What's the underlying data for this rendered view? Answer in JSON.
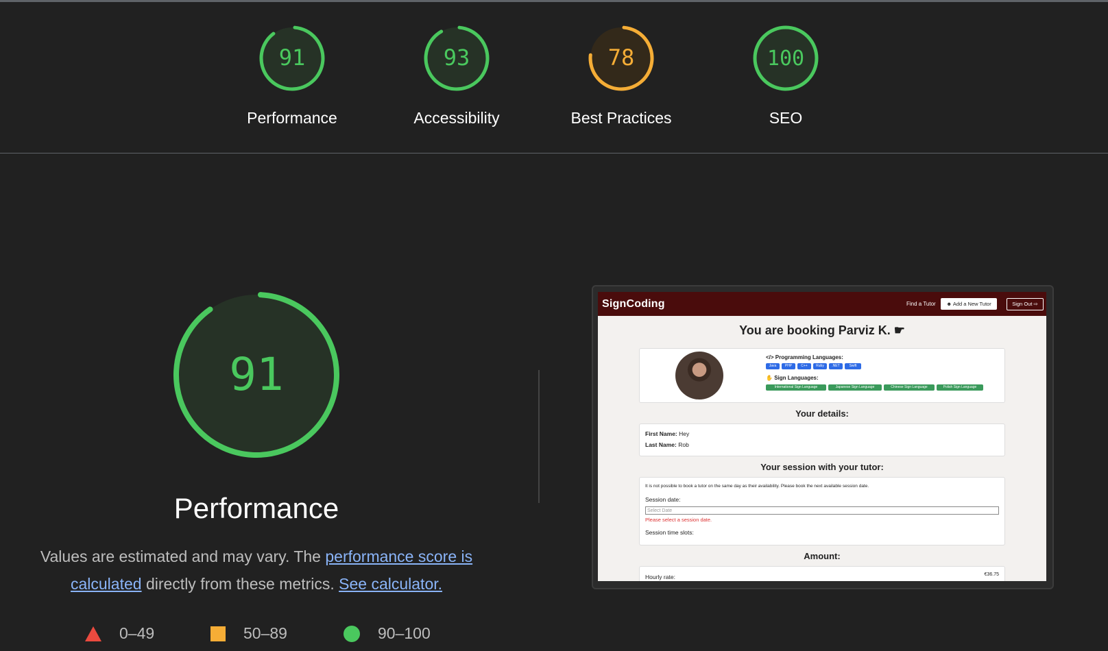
{
  "colors": {
    "good": "#0cce6b",
    "good_stroke": "#4ac85e",
    "average": "#ffa400",
    "poor": "#ff4e42",
    "background": "#212121",
    "link": "#8ab4f8"
  },
  "gauges": [
    {
      "score": "91",
      "label": "Performance",
      "level": "good"
    },
    {
      "score": "93",
      "label": "Accessibility",
      "level": "good"
    },
    {
      "score": "78",
      "label": "Best Practices",
      "level": "average"
    },
    {
      "score": "100",
      "label": "SEO",
      "level": "good"
    }
  ],
  "performance": {
    "score": "91",
    "title": "Performance",
    "desc_prefix": "Values are estimated and may vary. The ",
    "desc_link1": "performance score is calculated",
    "desc_middle": " directly from these metrics. ",
    "desc_link2": "See calculator."
  },
  "legend": [
    {
      "icon": "red-triangle-icon",
      "range": "0–49"
    },
    {
      "icon": "orange-square-icon",
      "range": "50–89"
    },
    {
      "icon": "green-circle-icon",
      "range": "90–100"
    }
  ],
  "screenshot": {
    "brand": "SignCoding",
    "nav_find": "Find a Tutor",
    "nav_add": "Add a New Tutor",
    "nav_signout": "Sign Out",
    "heading": "You are booking Parviz K.",
    "prog_lang_label": "</> Programming Languages:",
    "prog_langs": [
      "Java",
      "PHP",
      "C++",
      "Ruby",
      ".NET",
      "Swift"
    ],
    "sign_lang_label": "Sign Languages:",
    "sign_langs": [
      "International Sign Language",
      "Japanese Sign Language",
      "Chinese Sign Language",
      "Polish Sign Language"
    ],
    "details_heading": "Your details:",
    "first_name_label": "First Name:",
    "first_name": "Hey",
    "last_name_label": "Last Name:",
    "last_name": "Rob",
    "session_heading": "Your session with your tutor:",
    "session_note": "It is not possible to book a tutor on the same day as their availability. Please book the next available session date.",
    "session_date_label": "Session date:",
    "session_date_placeholder": "Select Date",
    "session_date_error": "Please select a session date.",
    "session_slots_label": "Session time slots:",
    "amount_heading": "Amount:",
    "hourly_rate_label": "Hourly rate:",
    "hourly_rate": "€36.75"
  }
}
